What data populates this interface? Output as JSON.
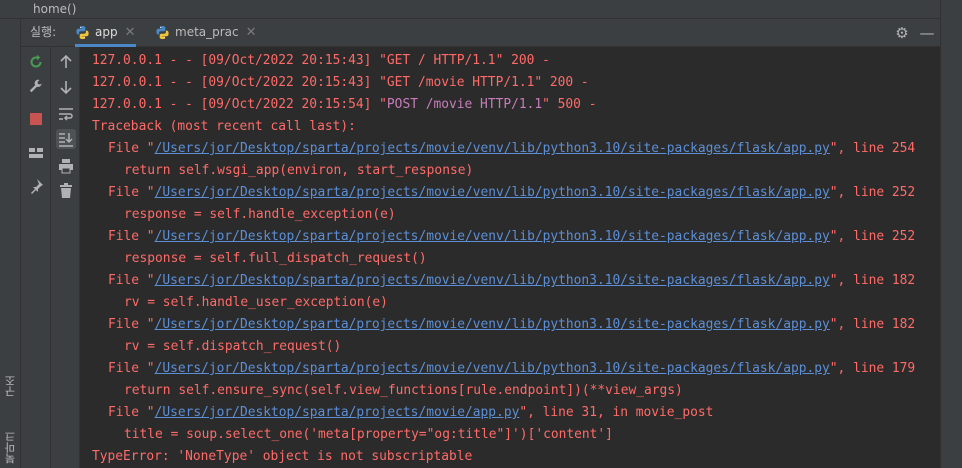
{
  "breadcrumb": "home()",
  "run_panel": {
    "label": "실행:",
    "tabs": [
      {
        "label": "app",
        "active": true
      },
      {
        "label": "meta_prac",
        "active": false
      }
    ]
  },
  "side_labels": {
    "structure": "구조",
    "bookmarks": "북마크"
  },
  "console": {
    "lines": [
      {
        "text": "127.0.0.1 - - [09/Oct/2022 20:15:43] \"GET / HTTP/1.1\" 200 -"
      },
      {
        "text": "127.0.0.1 - - [09/Oct/2022 20:15:43] \"GET /movie HTTP/1.1\" 200 -"
      },
      {
        "pre": "127.0.0.1 - - [09/Oct/2022 20:15:54] \"",
        "hl": "POST /movie HTTP/1.1",
        "post": "\" 500 -"
      },
      {
        "text": "Traceback (most recent call last):"
      },
      {
        "pre": "File \"",
        "link": "/Users/jor/Desktop/sparta/projects/movie/venv/lib/python3.10/site-packages/flask/app.py",
        "post": "\", line 254"
      },
      {
        "text": "return self.wsgi_app(environ, start_response)"
      },
      {
        "pre": "File \"",
        "link": "/Users/jor/Desktop/sparta/projects/movie/venv/lib/python3.10/site-packages/flask/app.py",
        "post": "\", line 252"
      },
      {
        "text": "response = self.handle_exception(e)"
      },
      {
        "pre": "File \"",
        "link": "/Users/jor/Desktop/sparta/projects/movie/venv/lib/python3.10/site-packages/flask/app.py",
        "post": "\", line 252"
      },
      {
        "text": "response = self.full_dispatch_request()"
      },
      {
        "pre": "File \"",
        "link": "/Users/jor/Desktop/sparta/projects/movie/venv/lib/python3.10/site-packages/flask/app.py",
        "post": "\", line 182"
      },
      {
        "text": "rv = self.handle_user_exception(e)"
      },
      {
        "pre": "File \"",
        "link": "/Users/jor/Desktop/sparta/projects/movie/venv/lib/python3.10/site-packages/flask/app.py",
        "post": "\", line 182"
      },
      {
        "text": "rv = self.dispatch_request()"
      },
      {
        "pre": "File \"",
        "link": "/Users/jor/Desktop/sparta/projects/movie/venv/lib/python3.10/site-packages/flask/app.py",
        "post": "\", line 179"
      },
      {
        "text": "return self.ensure_sync(self.view_functions[rule.endpoint])(**view_args)"
      },
      {
        "pre": "File \"",
        "link": "/Users/jor/Desktop/sparta/projects/movie/app.py",
        "post": "\", line 31, in movie_post"
      },
      {
        "text": "title = soup.select_one('meta[property=\"og:title\"]')['content']"
      },
      {
        "text": "TypeError: 'NoneType' object is not subscriptable"
      }
    ]
  },
  "colors": {
    "error_text": "#ff6b68",
    "link": "#5c8fd6",
    "highlight": "#c77dbb",
    "background": "#2b2b2b",
    "panel": "#3c3f41"
  }
}
